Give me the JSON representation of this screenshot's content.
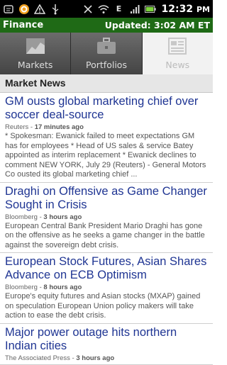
{
  "status_bar": {
    "time": "12:32",
    "time_suffix": "PM",
    "icons": [
      "notification-icon",
      "circle-app-icon",
      "warning-icon",
      "usb-icon",
      "vibrate-off-icon",
      "wifi-icon",
      "edge-icon",
      "signal-icon",
      "battery-icon"
    ]
  },
  "header": {
    "app_title": "Finance",
    "updated": "Updated: 3:02 AM ET"
  },
  "tabs": [
    {
      "label": "Markets",
      "icon": "chart-icon",
      "active": false
    },
    {
      "label": "Portfolios",
      "icon": "briefcase-icon",
      "active": false
    },
    {
      "label": "News",
      "icon": "newspaper-icon",
      "active": true
    }
  ],
  "section": {
    "title": "Market News"
  },
  "news": [
    {
      "title": "GM ousts global marketing chief over soccer deal-source",
      "source": "Reuters",
      "age": "17 minutes ago",
      "summary": "* Spokesman: Ewanick failed to meet expectations GM has for employees * Head of US sales & service Batey appointed as interim replacement * Ewanick declines to comment NEW YORK, July 29 (Reuters) - General Motors Co ousted its global marketing chief ..."
    },
    {
      "title": "Draghi on Offensive as Game Changer Sought in Crisis",
      "source": "Bloomberg",
      "age": "3 hours ago",
      "summary": "European Central Bank President Mario Draghi has gone on the offensive as he seeks a game changer in the battle against the sovereign debt crisis."
    },
    {
      "title": "European Stock Futures, Asian Shares Advance on ECB Optimism",
      "source": "Bloomberg",
      "age": "8 hours ago",
      "summary": "Europe's equity futures and Asian stocks (MXAP) gained on speculation European Union policy makers will take action to ease the debt crisis."
    },
    {
      "title": "Major power outage hits northern Indian cities",
      "source": "The Associated Press",
      "age": "3 hours ago",
      "summary": ""
    }
  ],
  "colors": {
    "header_bg": "#1f6a16",
    "title_link": "#1f3593"
  }
}
